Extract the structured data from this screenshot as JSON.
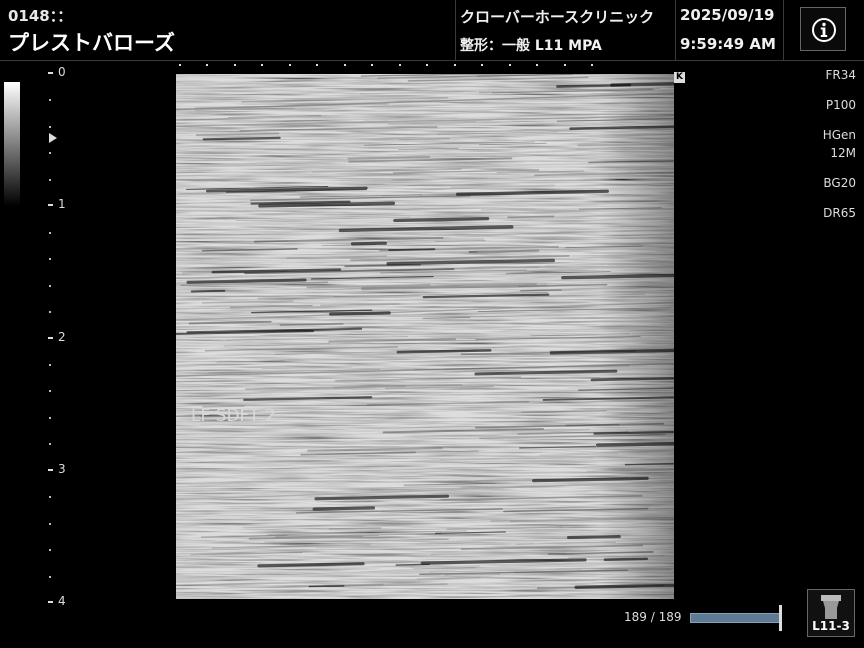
{
  "header": {
    "patient_id": "0148：：",
    "patient_name": "プレストバローズ",
    "clinic": "クローバーホースクリニック",
    "preset": "整形：一般 L11 MPA",
    "date": "2025/09/19",
    "time": "9:59:49 AM",
    "info_icon": "info-icon"
  },
  "depth_scale": {
    "labels": [
      "0",
      "1",
      "2",
      "3",
      "4"
    ],
    "unit_max": 4
  },
  "image": {
    "annotation": "LF SDFT 2",
    "orientation_marker": "K"
  },
  "params": {
    "frame_rate": "FR34",
    "power": "P100",
    "harmonic": "HGen",
    "frequency": "12M",
    "gain": "BG20",
    "dynamic_range": "DR65"
  },
  "cine": {
    "frames_text": "189 / 189",
    "position": 1.0
  },
  "probe": {
    "label": "L11-3",
    "icon": "linear-probe-icon"
  },
  "colors": {
    "cine_bar": "#5d7b95",
    "background": "#000000"
  }
}
